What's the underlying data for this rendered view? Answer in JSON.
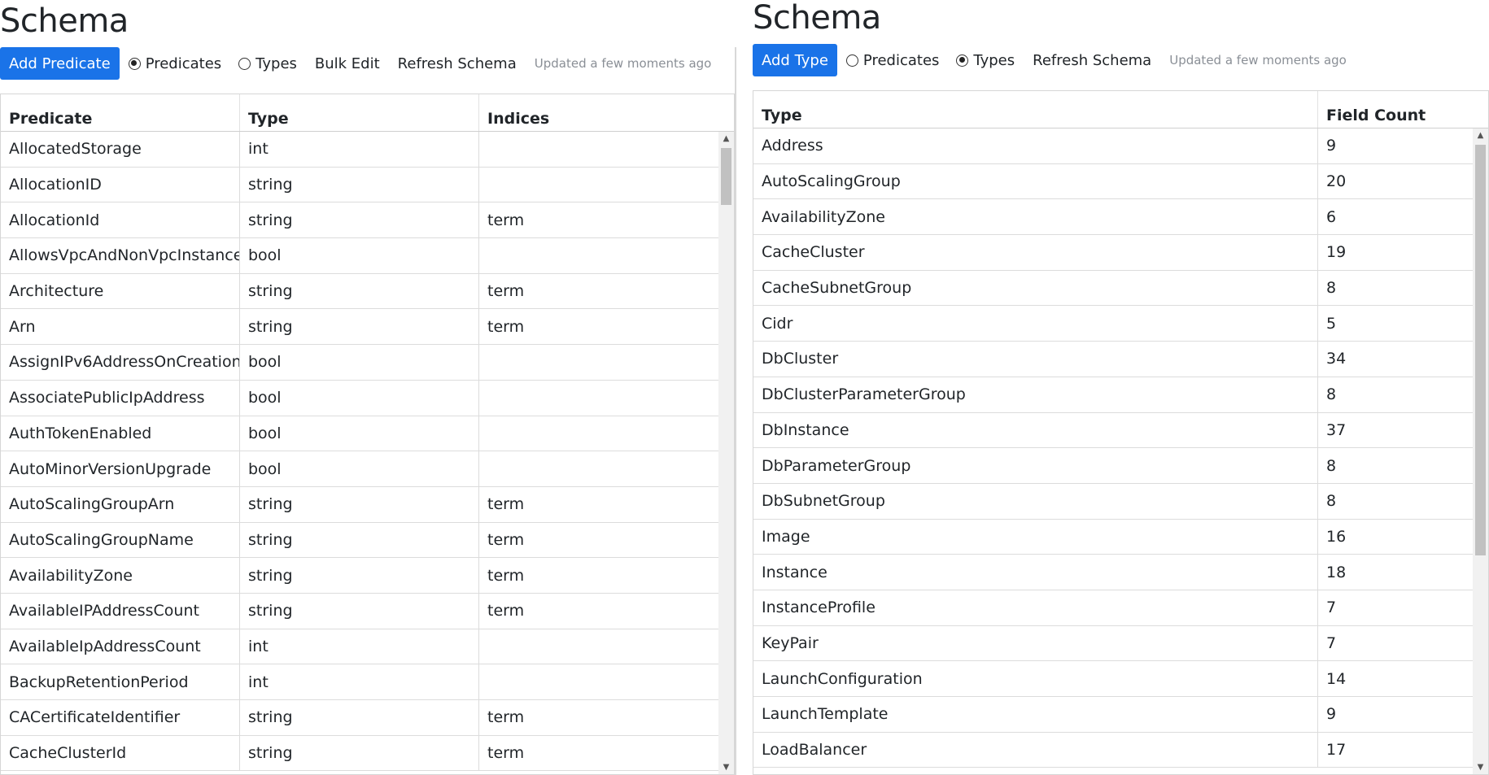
{
  "left": {
    "title": "Schema",
    "add_button": "Add Predicate",
    "radio_predicates": "Predicates",
    "radio_types": "Types",
    "selected": "predicates",
    "bulk_edit": "Bulk Edit",
    "refresh": "Refresh Schema",
    "updated": "Updated a few moments ago",
    "columns": [
      "Predicate",
      "Type",
      "Indices"
    ],
    "rows": [
      [
        "AllocatedStorage",
        "int",
        ""
      ],
      [
        "AllocationID",
        "string",
        ""
      ],
      [
        "AllocationId",
        "string",
        "term"
      ],
      [
        "AllowsVpcAndNonVpcInstanceI",
        "bool",
        ""
      ],
      [
        "Architecture",
        "string",
        "term"
      ],
      [
        "Arn",
        "string",
        "term"
      ],
      [
        "AssignIPv6AddressOnCreation",
        "bool",
        ""
      ],
      [
        "AssociatePublicIpAddress",
        "bool",
        ""
      ],
      [
        "AuthTokenEnabled",
        "bool",
        ""
      ],
      [
        "AutoMinorVersionUpgrade",
        "bool",
        ""
      ],
      [
        "AutoScalingGroupArn",
        "string",
        "term"
      ],
      [
        "AutoScalingGroupName",
        "string",
        "term"
      ],
      [
        "AvailabilityZone",
        "string",
        "term"
      ],
      [
        "AvailableIPAddressCount",
        "string",
        "term"
      ],
      [
        "AvailableIpAddressCount",
        "int",
        ""
      ],
      [
        "BackupRetentionPeriod",
        "int",
        ""
      ],
      [
        "CACertificateIdentifier",
        "string",
        "term"
      ],
      [
        "CacheClusterId",
        "string",
        "term"
      ]
    ]
  },
  "right": {
    "title": "Schema",
    "add_button": "Add Type",
    "radio_predicates": "Predicates",
    "radio_types": "Types",
    "selected": "types",
    "refresh": "Refresh Schema",
    "updated": "Updated a few moments ago",
    "columns": [
      "Type",
      "Field Count"
    ],
    "rows": [
      [
        "Address",
        "9"
      ],
      [
        "AutoScalingGroup",
        "20"
      ],
      [
        "AvailabilityZone",
        "6"
      ],
      [
        "CacheCluster",
        "19"
      ],
      [
        "CacheSubnetGroup",
        "8"
      ],
      [
        "Cidr",
        "5"
      ],
      [
        "DbCluster",
        "34"
      ],
      [
        "DbClusterParameterGroup",
        "8"
      ],
      [
        "DbInstance",
        "37"
      ],
      [
        "DbParameterGroup",
        "8"
      ],
      [
        "DbSubnetGroup",
        "8"
      ],
      [
        "Image",
        "16"
      ],
      [
        "Instance",
        "18"
      ],
      [
        "InstanceProfile",
        "7"
      ],
      [
        "KeyPair",
        "7"
      ],
      [
        "LaunchConfiguration",
        "14"
      ],
      [
        "LaunchTemplate",
        "9"
      ],
      [
        "LoadBalancer",
        "17"
      ]
    ]
  },
  "icons": {
    "scroll_up": "scroll-up-arrow-icon",
    "scroll_down": "scroll-down-arrow-icon"
  }
}
